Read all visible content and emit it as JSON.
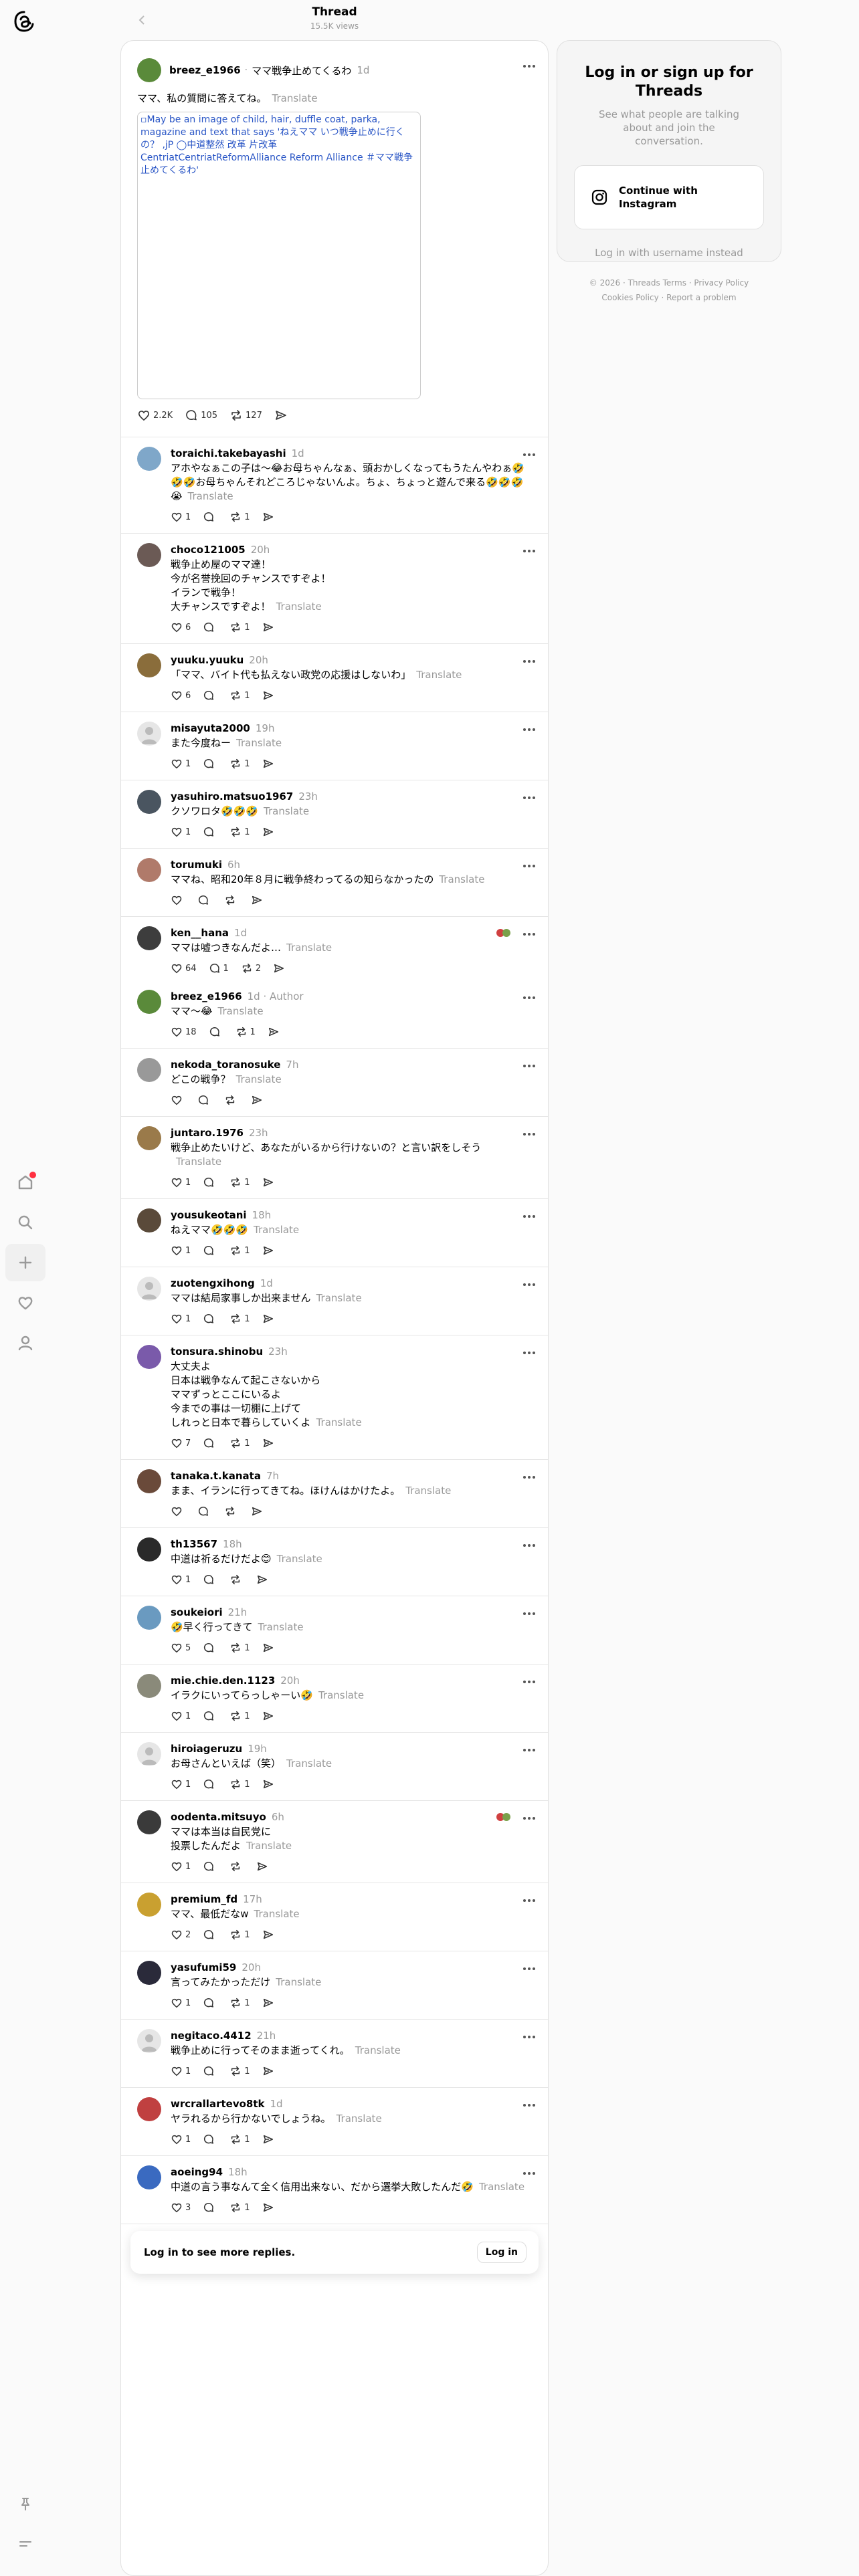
{
  "header": {
    "title": "Thread",
    "views": "15.5K views"
  },
  "op": {
    "username": "breez_e1966",
    "separator": "·",
    "topic": "ママ戦争止めてくるわ",
    "time": "1d",
    "text": "ママ、私の質問に答えてね。",
    "translate": "Translate",
    "image_alt": "May be an image of child, hair, duffle coat, parka, magazine and text that says 'ねえママ いつ戦争止めに行くの？ ,jP ◯中道整然 改革 片改革 CentriatCentriatReformAlliance Reform Alliance ＃ママ戦争止めてくるわ'",
    "likes": "2.2K",
    "comments": "105",
    "reposts": "127"
  },
  "replies": [
    {
      "user": "toraichi.takebayashi",
      "time": "1d",
      "text": "アホやなぁこの子は～😂お母ちゃんなぁ、頭おかしくなってもうたんやわぁ🤣🤣🤣お母ちゃんそれどころじゃないんよ。ちょ、ちょっと遊んで来る🤣🤣🤣😭",
      "likes": "1",
      "comments": "",
      "reposts": "1",
      "color": "#7fa7c9"
    },
    {
      "user": "choco121005",
      "time": "20h",
      "text": "戦争止め屋のママ達！\n今が名誉挽回のチャンスですぞよ！\nイランで戦争！\n大チャンスですぞよ！",
      "likes": "6",
      "comments": "",
      "reposts": "1",
      "color": "#6b5a55"
    },
    {
      "user": "yuuku.yuuku",
      "time": "20h",
      "text": "「ママ、バイト代も払えない政党の応援はしないわ」",
      "likes": "6",
      "comments": "",
      "reposts": "1",
      "color": "#8a6d3b"
    },
    {
      "user": "misayuta2000",
      "time": "19h",
      "text": "また今度ねー",
      "likes": "1",
      "comments": "",
      "reposts": "1",
      "color": "default"
    },
    {
      "user": "yasuhiro.matsuo1967",
      "time": "23h",
      "text": "クソワロタ🤣🤣🤣",
      "likes": "1",
      "comments": "",
      "reposts": "1",
      "color": "#4a5560"
    },
    {
      "user": "torumuki",
      "time": "6h",
      "text": "ママね、昭和20年８月に戦争終わってるの知らなかったの",
      "likes": "",
      "comments": "",
      "reposts": "",
      "color": "#b07a6a"
    },
    {
      "user": "ken__hana",
      "time": "1d",
      "text": "ママは嘘つきなんだよ…",
      "likes": "64",
      "comments": "1",
      "reposts": "2",
      "color": "#3d3d3d",
      "reacts": true,
      "noline": true
    },
    {
      "user": "breez_e1966",
      "time": "1d",
      "author": "Author",
      "text": "ママ〜😂",
      "likes": "18",
      "comments": "",
      "reposts": "1",
      "color": "#5a8a3a"
    },
    {
      "user": "nekoda_toranosuke",
      "time": "7h",
      "text": "どこの戦争？",
      "likes": "",
      "comments": "",
      "reposts": "",
      "color": "#999999"
    },
    {
      "user": "juntaro.1976",
      "time": "23h",
      "text": "戦争止めたいけど、あなたがいるから行けないの？と言い訳をしそう",
      "likes": "1",
      "comments": "",
      "reposts": "1",
      "color": "#9a7a4a"
    },
    {
      "user": "yousukeotani",
      "time": "18h",
      "text": "ねえママ🤣🤣🤣",
      "likes": "1",
      "comments": "",
      "reposts": "1",
      "color": "#5a4a3a"
    },
    {
      "user": "zuotengxihong",
      "time": "1d",
      "text": "ママは結局家事しか出来ません",
      "likes": "1",
      "comments": "",
      "reposts": "1",
      "color": "default"
    },
    {
      "user": "tonsura.shinobu",
      "time": "23h",
      "text": "大丈夫よ\n日本は戦争なんて起こさないから\nママずっとここにいるよ\n今までの事は一切棚に上げて\nしれっと日本で暮らしていくよ",
      "likes": "7",
      "comments": "",
      "reposts": "1",
      "color": "#7a5aaa"
    },
    {
      "user": "tanaka.t.kanata",
      "time": "7h",
      "text": "まま、イランに行ってきてね。ほけんはかけたよ。",
      "likes": "",
      "comments": "",
      "reposts": "",
      "color": "#6a4a3a"
    },
    {
      "user": "th13567",
      "time": "18h",
      "text": "中道は祈るだけだよ😊",
      "likes": "1",
      "comments": "",
      "reposts": "",
      "color": "#2a2a2a"
    },
    {
      "user": "soukeiori",
      "time": "21h",
      "text": "🤣早く行ってきて",
      "likes": "5",
      "comments": "",
      "reposts": "1",
      "color": "#6a9ac0"
    },
    {
      "user": "mie.chie.den.1123",
      "time": "20h",
      "text": "イラクにいってらっしゃーい🤣",
      "likes": "1",
      "comments": "",
      "reposts": "1",
      "color": "#8a8a7a"
    },
    {
      "user": "hiroiageruzu",
      "time": "19h",
      "text": "お母さんといえば（笑）",
      "likes": "1",
      "comments": "",
      "reposts": "1",
      "color": "default"
    },
    {
      "user": "oodenta.mitsuyo",
      "time": "6h",
      "text": "ママは本当は自民党に\n投票したんだよ",
      "likes": "1",
      "comments": "",
      "reposts": "",
      "color": "#3a3a3a",
      "reacts": true
    },
    {
      "user": "premium_fd",
      "time": "17h",
      "text": "ママ、最低だなw",
      "likes": "2",
      "comments": "",
      "reposts": "1",
      "color": "#c9a030"
    },
    {
      "user": "yasufumi59",
      "time": "20h",
      "text": "言ってみたかっただけ",
      "likes": "1",
      "comments": "",
      "reposts": "1",
      "color": "#2a2a3a"
    },
    {
      "user": "negitaco.4412",
      "time": "21h",
      "text": "戦争止めに行ってそのまま逝ってくれ。",
      "likes": "1",
      "comments": "",
      "reposts": "1",
      "color": "default"
    },
    {
      "user": "wrcrallartevo8tk",
      "time": "1d",
      "text": "ヤラれるから行かないでしょうね。",
      "likes": "1",
      "comments": "",
      "reposts": "1",
      "color": "#c04040"
    },
    {
      "user": "aoeing94",
      "time": "18h",
      "text": "中道の言う事なんて全く信用出来ない、だから選挙大敗したんだ🤣",
      "likes": "3",
      "comments": "",
      "reposts": "1",
      "color": "#3a6ac0"
    }
  ],
  "login_bar": {
    "text": "Log in to see more replies.",
    "button": "Log in"
  },
  "card": {
    "title": "Log in or sign up for Threads",
    "subtitle": "See what people are talking about and join the conversation.",
    "instagram_button": "Continue with Instagram",
    "alt_login": "Log in with username instead"
  },
  "footer": {
    "line1": "© 2026 · Threads Terms · Privacy Policy",
    "line2": "Cookies Policy · Report a problem"
  },
  "icons": {
    "logo": "threads-logo-icon",
    "home": "home-icon",
    "search": "search-icon",
    "create": "plus-icon",
    "activity": "heart-icon",
    "profile": "user-icon",
    "pin": "pin-icon",
    "menu": "menu-icon"
  }
}
